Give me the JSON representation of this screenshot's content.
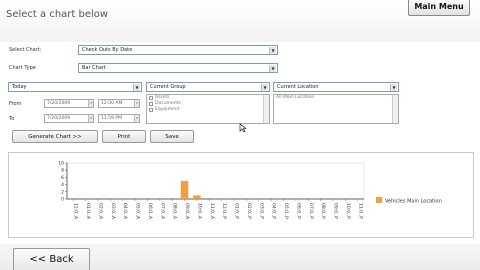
{
  "header": {
    "title": "Select a chart below",
    "main_menu": "Main Menu"
  },
  "form": {
    "select_chart_label": "Select Chart:",
    "select_chart_value": "Check Outs By Date",
    "chart_type_label": "Chart Type",
    "chart_type_value": "Bar Chart",
    "date_range_value": "Today",
    "group_value": "Current Group",
    "location_value": "Current Location",
    "from_label": "From",
    "to_label": "To",
    "from_date": "7/20/2009",
    "from_time": "12:00 AM",
    "to_date": "7/20/2009",
    "to_time": "11:59 PM",
    "group_options": [
      "Assets",
      "Documents",
      "Equipment"
    ],
    "location_options": [
      "All Main Location"
    ]
  },
  "buttons": {
    "generate": "Generate Chart >>",
    "print": "Print",
    "save": "Save",
    "back": "<< Back"
  },
  "chart_data": {
    "type": "bar",
    "yticks": [
      "10",
      "8",
      "6",
      "4",
      "2",
      "0"
    ],
    "ylim": [
      0,
      10
    ],
    "categories": [
      "12:00 AM",
      "1:00 AM",
      "2:00 AM",
      "3:00 AM",
      "4:00 AM",
      "5:00 AM",
      "6:00 AM",
      "7:00 AM",
      "8:00 AM",
      "9:00 AM",
      "10:00 AM",
      "11:00 AM",
      "12:00 PM",
      "1:00 PM",
      "2:00 PM",
      "3:00 PM",
      "4:00 PM",
      "5:00 PM",
      "6:00 PM",
      "7:00 PM",
      "8:00 PM",
      "9:00 PM",
      "10:00 PM",
      "11:00 PM"
    ],
    "category_labels": [
      "12:0..A",
      "01:0..A",
      "02:0..A",
      "03:0..A",
      "04:0..A",
      "05:0..A",
      "06:0..A",
      "07:0..A",
      "08:0..A",
      "09:0..A",
      "10:0..A",
      "11:0..A",
      "12:0..P",
      "01:0..P",
      "02:0..P",
      "03:0..P",
      "04:0..P",
      "05:0..P",
      "06:0..P",
      "07:0..P",
      "08:0..P",
      "09:0..P",
      "10:0..P",
      "11:0..P"
    ],
    "series": [
      {
        "name": "Vehicles Main Location",
        "color": "#f0a040",
        "values": [
          0,
          0,
          0,
          0,
          0,
          0,
          0,
          0,
          0,
          5,
          1,
          0,
          0,
          0,
          0,
          0,
          0,
          0,
          0,
          0,
          0,
          0,
          0,
          0
        ]
      }
    ],
    "legend_position": "right"
  }
}
